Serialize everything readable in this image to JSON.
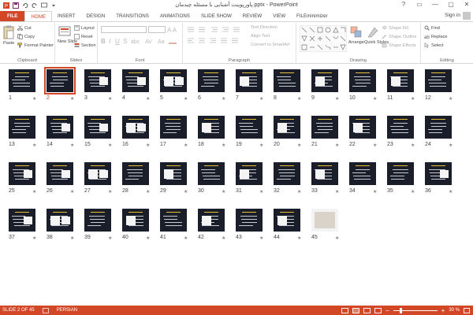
{
  "app": {
    "title": "پاورپوینت آشنایی با مسئله چیدمان.pptx - PowerPoint",
    "window_controls": [
      "?",
      "▭",
      "—",
      "▢",
      "✕"
    ]
  },
  "tabs": [
    {
      "label": "FILE"
    },
    {
      "label": "HOME"
    },
    {
      "label": "INSERT"
    },
    {
      "label": "DESIGN"
    },
    {
      "label": "TRANSITIONS"
    },
    {
      "label": "ANIMATIONS"
    },
    {
      "label": "SLIDE SHOW"
    },
    {
      "label": "REVIEW"
    },
    {
      "label": "VIEW"
    },
    {
      "label": "FILEminimizer"
    }
  ],
  "signin": "Sign in",
  "ribbon": {
    "clipboard": {
      "label": "Clipboard",
      "paste": "Paste",
      "cut": "Cut",
      "copy": "Copy",
      "format_painter": "Format Painter"
    },
    "slides": {
      "label": "Slides",
      "new_slide": "New Slide",
      "layout": "Layout",
      "reset": "Reset",
      "section": "Section"
    },
    "font": {
      "label": "Font"
    },
    "paragraph": {
      "label": "Paragraph",
      "text_direction": "Text Direction",
      "align_text": "Align Text",
      "convert_smartart": "Convert to SmartArt"
    },
    "drawing": {
      "label": "Drawing",
      "arrange": "Arrange",
      "quick_styles": "Quick Styles",
      "shape_fill": "Shape Fill",
      "shape_outline": "Shape Outline",
      "shape_effects": "Shape Effects"
    },
    "editing": {
      "label": "Editing",
      "find": "Find",
      "replace": "Replace",
      "select": "Select"
    }
  },
  "slides": {
    "count": 45,
    "selected": 2,
    "numbers": [
      "1",
      "2",
      "3",
      "4",
      "5",
      "6",
      "7",
      "8",
      "9",
      "10",
      "11",
      "12",
      "13",
      "14",
      "15",
      "16",
      "17",
      "18",
      "19",
      "20",
      "21",
      "22",
      "23",
      "24",
      "25",
      "26",
      "27",
      "28",
      "29",
      "30",
      "31",
      "32",
      "33",
      "34",
      "35",
      "36",
      "37",
      "38",
      "39",
      "40",
      "41",
      "42",
      "43",
      "44",
      "45"
    ],
    "star": "★"
  },
  "status": {
    "slide_of": "SLIDE 2 OF 45",
    "language": "PERSIAN",
    "zoom": "30 %"
  },
  "colors": {
    "accent": "#d24726",
    "slide_bg": "#1a1e2a",
    "highlight": "#e8c033"
  }
}
